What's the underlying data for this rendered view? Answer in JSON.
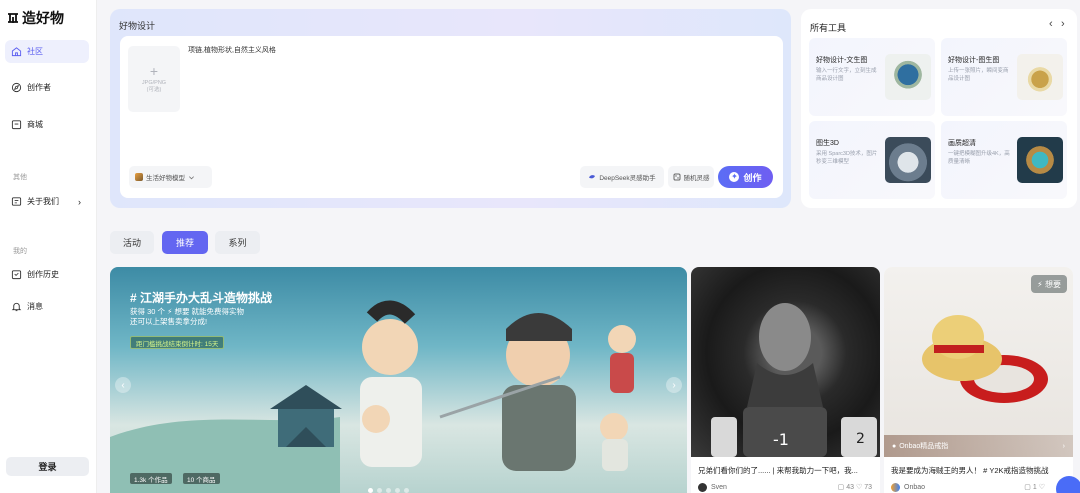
{
  "brand": {
    "name": "造好物"
  },
  "sidebar": {
    "nav": [
      {
        "label": "社区",
        "icon": "home-icon",
        "active": true
      },
      {
        "label": "创作者",
        "icon": "compass-icon"
      },
      {
        "label": "商城",
        "icon": "shop-icon"
      }
    ],
    "section_other": "其他",
    "about": {
      "label": "关于我们",
      "icon": "info-icon",
      "arrow": "›"
    },
    "section_mine": "我的",
    "mine": [
      {
        "label": "创作历史",
        "icon": "history-icon"
      },
      {
        "label": "消息",
        "icon": "bell-icon"
      }
    ],
    "login": "登录"
  },
  "design": {
    "title": "好物设计",
    "upload_plus": "+",
    "upload_hint": "JPG/PNG\n(可选)",
    "prompt": "项链,植物形状,自然主义风格",
    "model_label": "生活好物模型",
    "deepseek_label": "DeepSeek灵感助手",
    "random_label": "随机灵感",
    "create_label": "创作"
  },
  "tools": {
    "title": "所有工具",
    "prev": "‹",
    "next": "›",
    "items": [
      {
        "name": "好物设计-文生图",
        "desc": "输入一行文字，立刻生成商品设计图"
      },
      {
        "name": "好物设计-图生图",
        "desc": "上传一张照片，瞬间变商品设计图"
      },
      {
        "name": "图生3D",
        "desc": "采用 Sparc3D技术，图片秒变三维模型"
      },
      {
        "name": "画质超清",
        "desc": "一键把模糊图升级4K，高质量清晰"
      }
    ]
  },
  "tabs": [
    {
      "label": "活动",
      "active": false
    },
    {
      "label": "推荐",
      "active": true
    },
    {
      "label": "系列",
      "active": false
    }
  ],
  "banner": {
    "title": "# 江湖手办大乱斗造物挑战",
    "subtitle": "获得 30 个 ⚡ 想要 就能免费得实物\n还可以上架售卖拿分成!",
    "countdown": "距门槛挑战结束倒计时: 15天",
    "stat_works": "1.3k 个作品",
    "stat_goods": "10 个商品",
    "prev": "‹",
    "next": "›"
  },
  "posts": [
    {
      "caption": "兄弟们看你们的了...... | 来帮我助力一下吧，我...",
      "author": "Sven",
      "comments": "43",
      "likes": "73"
    },
    {
      "caption": "我是要成为海贼王的男人！ # Y2K戒指造物挑战",
      "author": "Onbao",
      "comments": "1",
      "likes": "",
      "wish": "⚡ 想要",
      "tag": "Onbao精品戒指",
      "tag_arrow": "›"
    }
  ]
}
